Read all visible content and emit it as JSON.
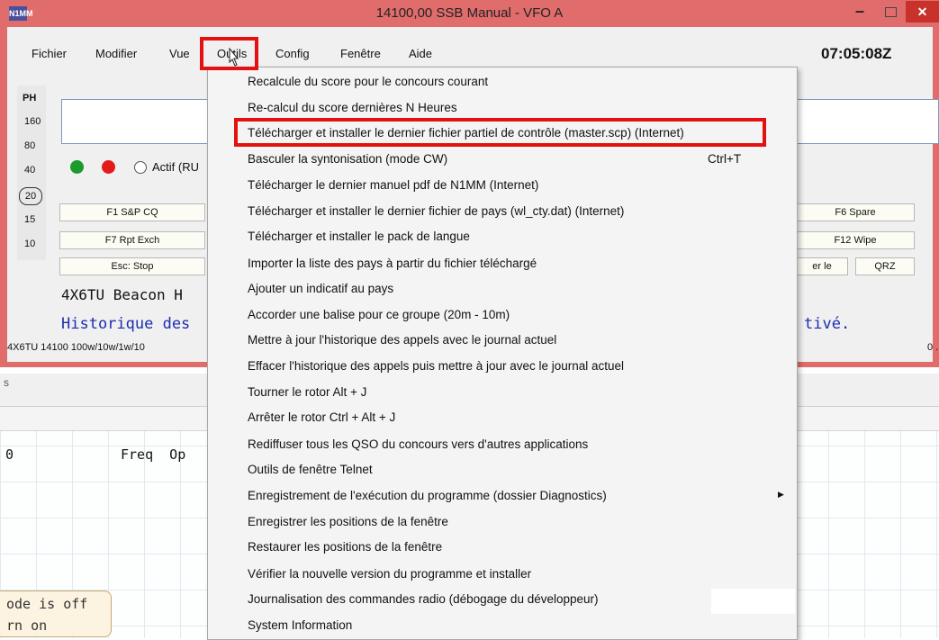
{
  "window": {
    "title": "14100,00 SSB Manual - VFO A",
    "logo": "N1MM",
    "clock": "07:05:08Z"
  },
  "menubar": [
    "Fichier",
    "Modifier",
    "Vue",
    "Outils",
    "Config",
    "Fenêtre",
    "Aide"
  ],
  "bands": {
    "mode": "PH",
    "list": [
      "160",
      "80",
      "40",
      "20",
      "15",
      "10"
    ],
    "selected": "20"
  },
  "controls": {
    "actif_label": "Actif (RU"
  },
  "fkeys": {
    "row1": [
      "F1 S&P CQ",
      "F6 Spare"
    ],
    "row2": [
      "F7 Rpt Exch",
      "F12 Wipe"
    ],
    "row3": [
      "Esc: Stop",
      "er le",
      "QRZ"
    ]
  },
  "entry_window": {
    "beacon_text": "4X6TU Beacon H",
    "history_text": "Historique des",
    "history_right": "tivé.",
    "status_text": "4X6TU 14100 100w/10w/1w/10",
    "status_right": "0 ."
  },
  "background": {
    "tab_fragment": "s",
    "col0": "0",
    "col_freq": "Freq  Op",
    "notice_line1": "ode is off",
    "notice_line2": "rn on"
  },
  "outils_menu": [
    {
      "label": "Recalcule du score pour le concours courant"
    },
    {
      "label": "Re-calcul du score dernières N Heures"
    },
    {
      "label": "Télécharger et installer le dernier fichier partiel de contrôle (master.scp) (Internet)"
    },
    {
      "label": "Basculer la syntonisation (mode CW)",
      "shortcut": "Ctrl+T"
    },
    {
      "label": "Télécharger le dernier manuel pdf de N1MM (Internet)"
    },
    {
      "label": "Télécharger et installer le dernier fichier de pays (wl_cty.dat) (Internet)"
    },
    {
      "label": "Télécharger et installer le pack de langue"
    },
    {
      "label": "Importer la liste des pays à partir du fichier téléchargé"
    },
    {
      "label": "Ajouter un indicatif au pays"
    },
    {
      "label": "Accorder une balise pour ce groupe (20m - 10m)"
    },
    {
      "label": "Mettre à jour l'historique des appels avec le journal actuel"
    },
    {
      "label": "Effacer l'historique des appels puis mettre à jour avec le journal actuel"
    },
    {
      "label": "Tourner le rotor Alt + J"
    },
    {
      "label": "Arrêter le rotor Ctrl + Alt + J"
    },
    {
      "label": "Rediffuser tous les QSO du concours vers d'autres applications"
    },
    {
      "label": "Outils de fenêtre Telnet"
    },
    {
      "label": "Enregistrement de l'exécution du programme (dossier Diagnostics)",
      "submenu": "▶"
    },
    {
      "label": "Enregistrer les positions de la fenêtre"
    },
    {
      "label": "Restaurer les positions de la fenêtre"
    },
    {
      "label": "Vérifier la nouvelle version du programme et installer"
    },
    {
      "label": "Journalisation des commandes radio (débogage du développeur)"
    },
    {
      "label": "System Information"
    }
  ],
  "colors": {
    "window_frame": "#e06c6c",
    "highlight_box": "#e41111",
    "history_text": "#1c2db0"
  }
}
